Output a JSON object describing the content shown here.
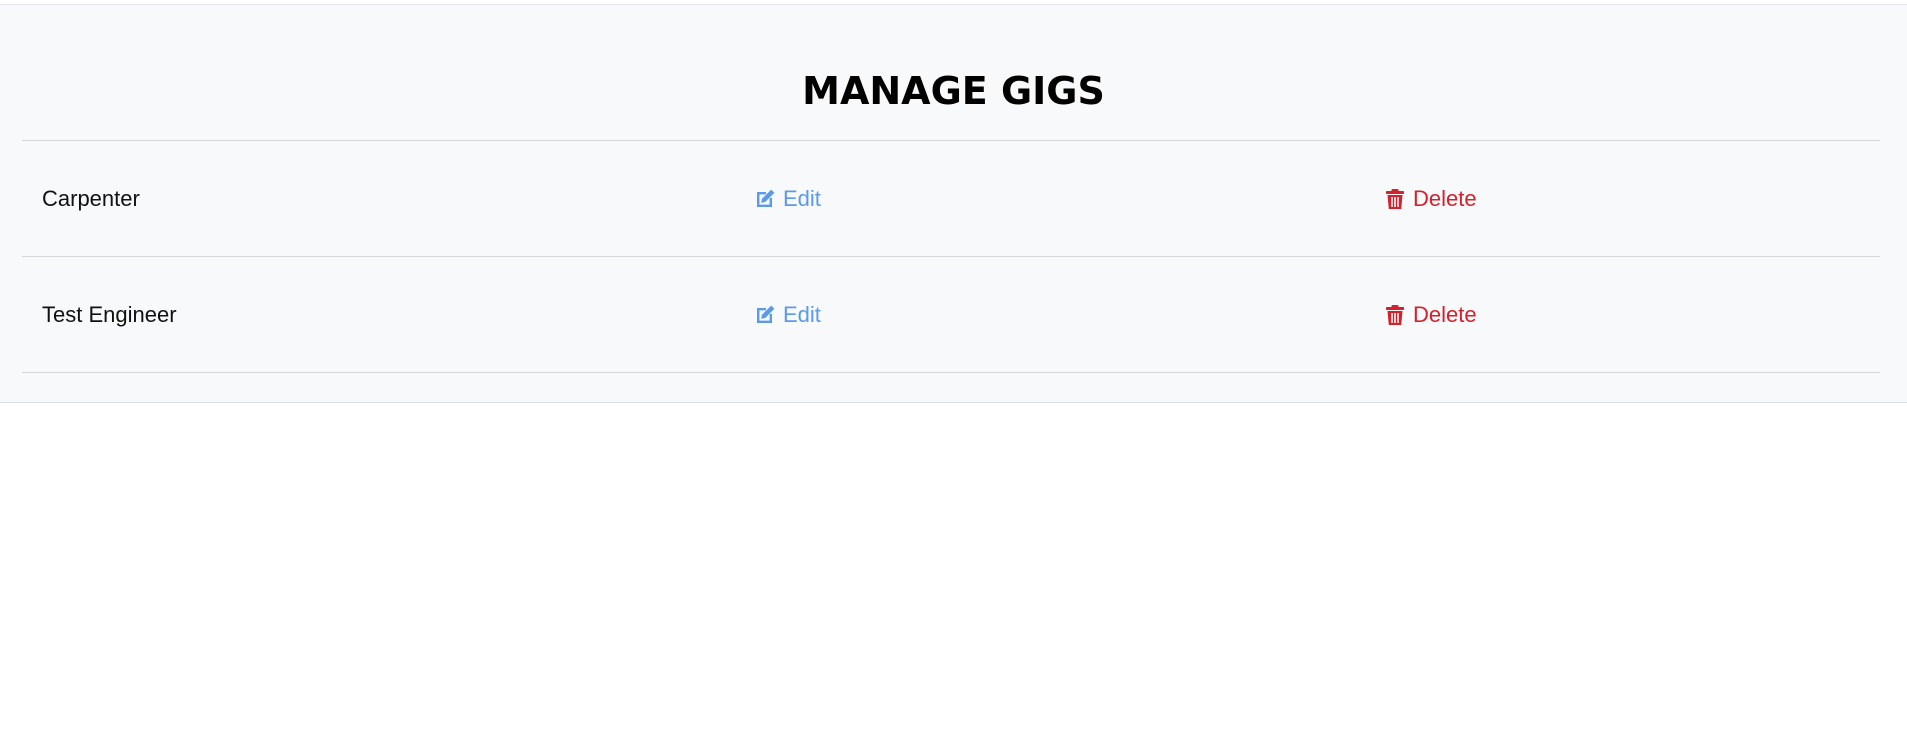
{
  "page": {
    "title": "MANAGE GIGS"
  },
  "colors": {
    "edit": "#5b9ae6",
    "delete": "#d3222e",
    "panel_bg": "#f8f9fa"
  },
  "gigs": [
    {
      "name": "Carpenter",
      "edit_label": "Edit",
      "edit_icon": "edit-icon",
      "delete_label": "Delete",
      "delete_icon": "trash-icon"
    },
    {
      "name": "Test Engineer",
      "edit_label": "Edit",
      "edit_icon": "edit-icon",
      "delete_label": "Delete",
      "delete_icon": "trash-icon"
    }
  ]
}
